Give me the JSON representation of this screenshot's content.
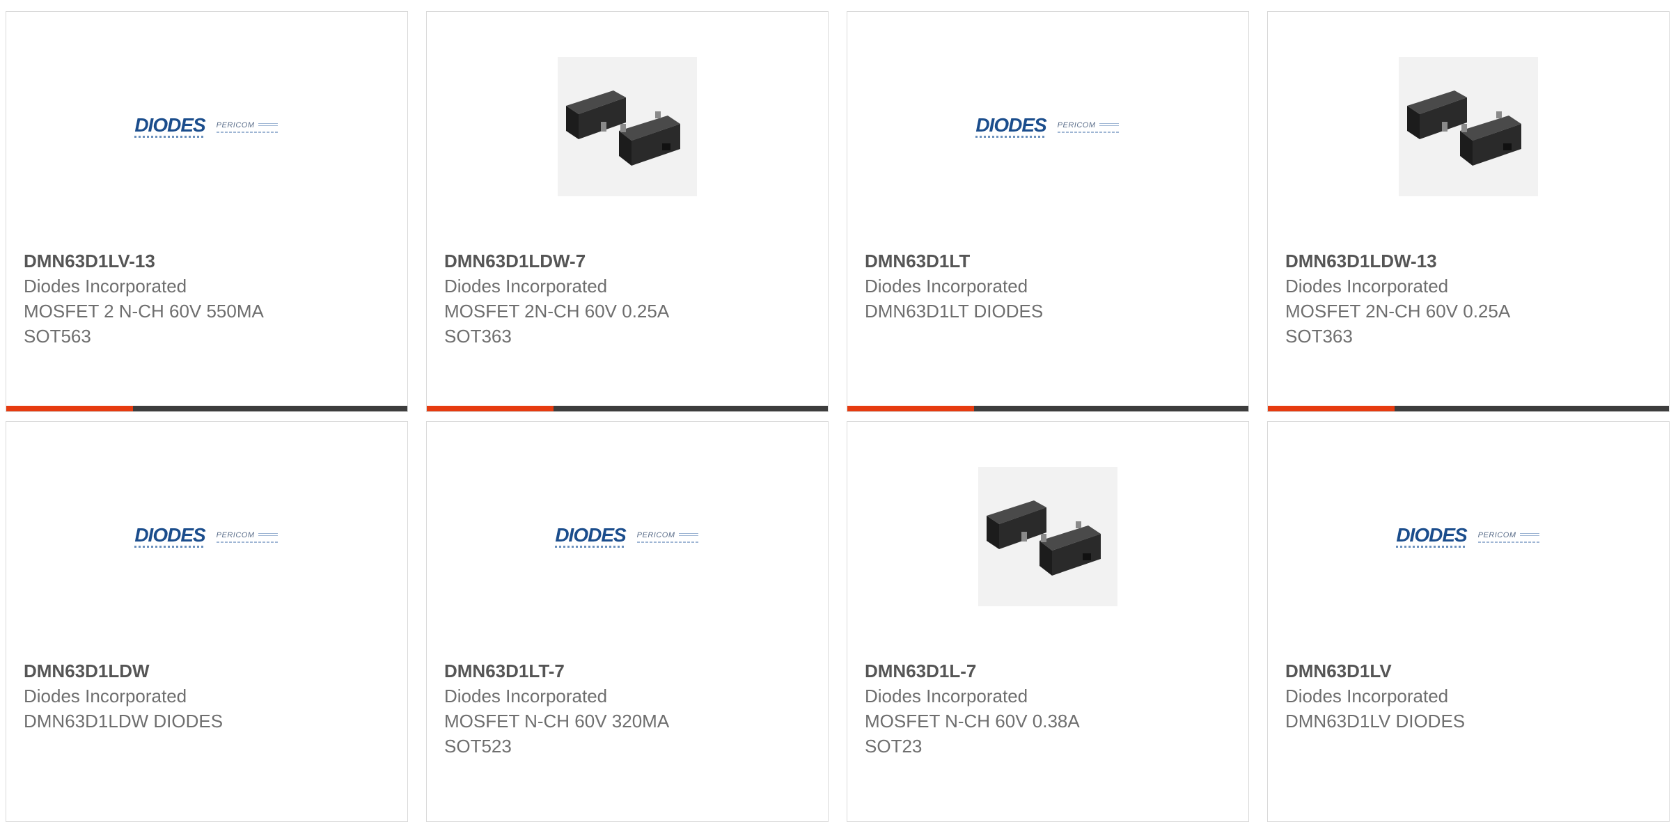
{
  "colors": {
    "accent": "#e63b10",
    "bar": "#3d3d3d",
    "brand_blue": "#1b4d8c"
  },
  "products": [
    {
      "part_number": "DMN63D1LV-13",
      "manufacturer": "Diodes Incorporated",
      "description": [
        "MOSFET 2 N-CH 60V 550MA",
        "SOT563"
      ],
      "image": "diodes-pericom-logo"
    },
    {
      "part_number": "DMN63D1LDW-7",
      "manufacturer": "Diodes Incorporated",
      "description": [
        "MOSFET 2N-CH 60V 0.25A",
        "SOT363"
      ],
      "image": "sot-package-photo"
    },
    {
      "part_number": "DMN63D1LT",
      "manufacturer": "Diodes Incorporated",
      "description": [
        "DMN63D1LT DIODES"
      ],
      "image": "diodes-pericom-logo"
    },
    {
      "part_number": "DMN63D1LDW-13",
      "manufacturer": "Diodes Incorporated",
      "description": [
        "MOSFET 2N-CH 60V 0.25A",
        "SOT363"
      ],
      "image": "sot-package-photo"
    },
    {
      "part_number": "DMN63D1LDW",
      "manufacturer": "Diodes Incorporated",
      "description": [
        "DMN63D1LDW DIODES"
      ],
      "image": "diodes-pericom-logo"
    },
    {
      "part_number": "DMN63D1LT-7",
      "manufacturer": "Diodes Incorporated",
      "description": [
        "MOSFET N-CH 60V 320MA",
        "SOT523"
      ],
      "image": "diodes-pericom-logo"
    },
    {
      "part_number": "DMN63D1L-7",
      "manufacturer": "Diodes Incorporated",
      "description": [
        "MOSFET N-CH 60V 0.38A",
        "SOT23"
      ],
      "image": "sot-package-photo"
    },
    {
      "part_number": "DMN63D1LV",
      "manufacturer": "Diodes Incorporated",
      "description": [
        "DMN63D1LV DIODES"
      ],
      "image": "diodes-pericom-logo"
    }
  ],
  "logo": {
    "brand_text": "DIODES",
    "partner_text": "PERICOM"
  }
}
